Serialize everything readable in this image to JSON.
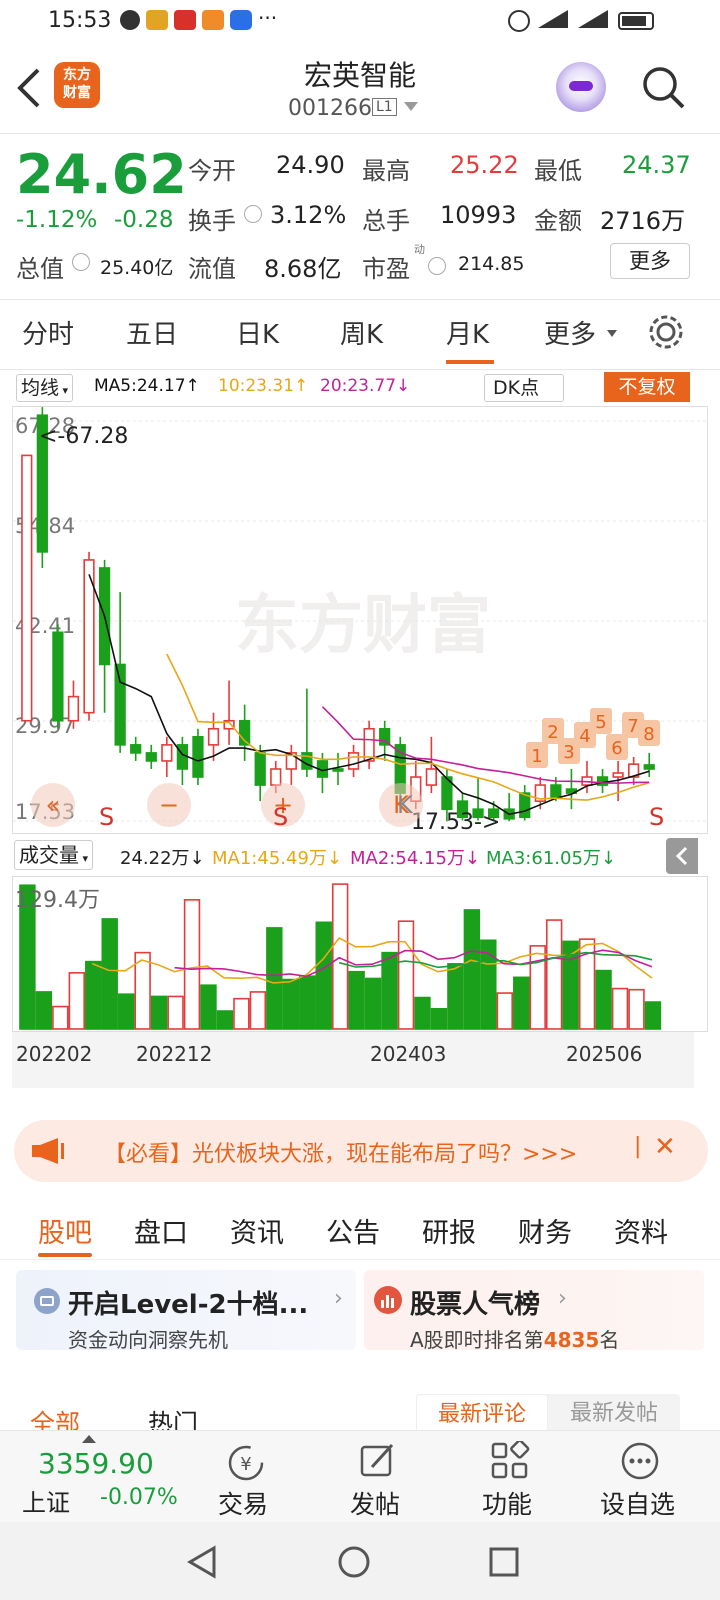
{
  "status_bar": {
    "time": "15:53",
    "dots": "···"
  },
  "header": {
    "logo_text": "东方\n财富",
    "title": "宏英智能",
    "code": "001266",
    "level": "L1"
  },
  "quote": {
    "price": "24.62",
    "change_pct": "-1.12%",
    "change": "-0.28",
    "open_label": "今开",
    "open": "24.90",
    "high_label": "最高",
    "high": "25.22",
    "low_label": "最低",
    "low": "24.37",
    "turnover_label": "换手",
    "turnover": "3.12%",
    "volume_label": "总手",
    "volume": "10993",
    "amount_label": "金额",
    "amount": "2716万",
    "mktcap_label": "总值",
    "mktcap": "25.40亿",
    "float_label": "流值",
    "float": "8.68亿",
    "pe_label": "市盈",
    "pe_sup": "动",
    "pe": "214.85",
    "more": "更多"
  },
  "tabs": [
    "分时",
    "五日",
    "日K",
    "周K",
    "月K",
    "更多"
  ],
  "active_tab": "月K",
  "ma_bar": {
    "selector": "均线",
    "ma5": "MA5:24.17↑",
    "ma10": "10:23.31↑",
    "ma20": "20:23.77↓",
    "dk": "DK点",
    "adjust": "不复权"
  },
  "chart_data": {
    "type": "candlestick",
    "y_ticks": [
      "67.28",
      "54.84",
      "42.41",
      "29.97",
      "17.53"
    ],
    "ylim": [
      17.53,
      67.28
    ],
    "max_label": "<-67.28",
    "min_label": "17.53->",
    "watermark": "东方财富",
    "markers": [
      "1",
      "2",
      "3",
      "4",
      "5",
      "6",
      "7",
      "8"
    ],
    "signals": [
      "S",
      "S",
      "K",
      "S"
    ],
    "nav_icons": [
      "«",
      "−",
      "+",
      "K"
    ],
    "candles": [
      {
        "o": 30,
        "c": 63,
        "h": 63,
        "l": 30,
        "up": true
      },
      {
        "o": 51,
        "c": 68,
        "h": 69,
        "l": 49,
        "up": false
      },
      {
        "o": 41,
        "c": 30,
        "h": 42,
        "l": 29,
        "up": false
      },
      {
        "o": 33,
        "c": 30,
        "h": 35,
        "l": 29,
        "up": true
      },
      {
        "o": 31,
        "c": 50,
        "h": 51,
        "l": 30,
        "up": true
      },
      {
        "o": 49,
        "c": 37,
        "h": 50,
        "l": 31,
        "up": false
      },
      {
        "o": 37,
        "c": 27,
        "h": 46,
        "l": 26,
        "up": false
      },
      {
        "o": 27,
        "c": 26,
        "h": 28,
        "l": 25,
        "up": false
      },
      {
        "o": 26,
        "c": 25,
        "h": 27,
        "l": 24,
        "up": false
      },
      {
        "o": 25,
        "c": 27,
        "h": 28,
        "l": 23,
        "up": true
      },
      {
        "o": 27,
        "c": 24,
        "h": 28,
        "l": 22,
        "up": false
      },
      {
        "o": 28,
        "c": 23,
        "h": 29,
        "l": 22,
        "up": false
      },
      {
        "o": 27,
        "c": 29,
        "h": 31,
        "l": 25,
        "up": true
      },
      {
        "o": 29,
        "c": 30,
        "h": 35,
        "l": 27,
        "up": true
      },
      {
        "o": 30,
        "c": 27,
        "h": 32,
        "l": 25,
        "up": false
      },
      {
        "o": 26,
        "c": 22,
        "h": 27,
        "l": 20,
        "up": false
      },
      {
        "o": 22,
        "c": 24,
        "h": 25,
        "l": 21,
        "up": true
      },
      {
        "o": 24,
        "c": 26,
        "h": 27,
        "l": 22,
        "up": true
      },
      {
        "o": 26,
        "c": 24,
        "h": 34,
        "l": 23,
        "up": false
      },
      {
        "o": 25,
        "c": 23,
        "h": 26,
        "l": 21,
        "up": false
      },
      {
        "o": 24,
        "c": 24,
        "h": 26,
        "l": 22,
        "up": false
      },
      {
        "o": 24,
        "c": 26,
        "h": 27,
        "l": 23,
        "up": true
      },
      {
        "o": 25,
        "c": 29,
        "h": 30,
        "l": 24,
        "up": true
      },
      {
        "o": 29,
        "c": 27,
        "h": 30,
        "l": 25,
        "up": false
      },
      {
        "o": 27,
        "c": 21,
        "h": 28,
        "l": 20,
        "up": false
      },
      {
        "o": 20,
        "c": 23,
        "h": 25,
        "l": 19,
        "up": true
      },
      {
        "o": 22,
        "c": 24,
        "h": 28,
        "l": 21,
        "up": true
      },
      {
        "o": 23,
        "c": 19,
        "h": 24,
        "l": 17.5,
        "up": false
      },
      {
        "o": 20,
        "c": 18,
        "h": 21,
        "l": 17.6,
        "up": false
      },
      {
        "o": 19,
        "c": 18,
        "h": 23,
        "l": 17.6,
        "up": false
      },
      {
        "o": 18,
        "c": 19,
        "h": 20,
        "l": 17.5,
        "up": false
      },
      {
        "o": 19,
        "c": 17.8,
        "h": 21,
        "l": 17.5,
        "up": false
      },
      {
        "o": 18,
        "c": 21,
        "h": 22,
        "l": 17.6,
        "up": false
      },
      {
        "o": 20,
        "c": 22,
        "h": 23,
        "l": 19,
        "up": true
      },
      {
        "o": 20.5,
        "c": 22,
        "h": 23,
        "l": 20,
        "up": false
      },
      {
        "o": 21,
        "c": 21.5,
        "h": 24,
        "l": 19,
        "up": false
      },
      {
        "o": 22,
        "c": 23,
        "h": 25,
        "l": 21,
        "up": true
      },
      {
        "o": 22,
        "c": 23,
        "h": 24,
        "l": 21,
        "up": false
      },
      {
        "o": 23,
        "c": 23.5,
        "h": 25,
        "l": 20,
        "up": true
      },
      {
        "o": 23,
        "c": 24.6,
        "h": 25.5,
        "l": 22,
        "up": true
      },
      {
        "o": 24,
        "c": 24.5,
        "h": 26,
        "l": 23,
        "up": false
      }
    ],
    "volume": {
      "label": "成交量",
      "values_text": {
        "vol": "24.22万↓",
        "ma1": "MA1:45.49万↓",
        "ma2": "MA2:54.15万↓",
        "ma3": "MA3:61.05万↓"
      },
      "max_label": "129.4万",
      "bars": [
        {
          "v": 128,
          "up": false
        },
        {
          "v": 33,
          "up": false
        },
        {
          "v": 20,
          "up": true
        },
        {
          "v": 50,
          "up": true
        },
        {
          "v": 60,
          "up": false
        },
        {
          "v": 98,
          "up": false
        },
        {
          "v": 31,
          "up": false
        },
        {
          "v": 68,
          "up": true
        },
        {
          "v": 29,
          "up": false
        },
        {
          "v": 29,
          "up": true
        },
        {
          "v": 115,
          "up": true
        },
        {
          "v": 39,
          "up": false
        },
        {
          "v": 16,
          "up": false
        },
        {
          "v": 27,
          "up": true
        },
        {
          "v": 33,
          "up": true
        },
        {
          "v": 90,
          "up": false
        },
        {
          "v": 44,
          "up": false
        },
        {
          "v": 47,
          "up": false
        },
        {
          "v": 95,
          "up": false
        },
        {
          "v": 129,
          "up": true
        },
        {
          "v": 51,
          "up": false
        },
        {
          "v": 45,
          "up": false
        },
        {
          "v": 68,
          "up": false
        },
        {
          "v": 96,
          "up": true
        },
        {
          "v": 28,
          "up": false
        },
        {
          "v": 18,
          "up": false
        },
        {
          "v": 58,
          "up": false
        },
        {
          "v": 106,
          "up": false
        },
        {
          "v": 79,
          "up": false
        },
        {
          "v": 32,
          "up": true
        },
        {
          "v": 46,
          "up": false
        },
        {
          "v": 74,
          "up": true
        },
        {
          "v": 97,
          "up": true
        },
        {
          "v": 78,
          "up": false
        },
        {
          "v": 80,
          "up": true
        },
        {
          "v": 52,
          "up": false
        },
        {
          "v": 36,
          "up": true
        },
        {
          "v": 35,
          "up": true
        },
        {
          "v": 24,
          "up": false
        }
      ]
    },
    "x_ticks": [
      "202202",
      "202212",
      "202403",
      "202506"
    ]
  },
  "promo": {
    "text": "【必看】光伏板块大涨，现在能布局了吗？>>>",
    "sep": "|",
    "close": "✕"
  },
  "section_tabs": [
    "股吧",
    "盘口",
    "资讯",
    "公告",
    "研报",
    "财务",
    "资料"
  ],
  "cards": [
    {
      "title": "开启Level-2十档...",
      "sub": "资金动向洞察先机"
    },
    {
      "title": "股票人气榜",
      "sub_prefix": "A股即时排名第",
      "rank": "4835",
      "sub_suffix": "名"
    }
  ],
  "comment_tabs": {
    "all": "全部",
    "hot": "热门",
    "latest_comment": "最新评论",
    "latest_post": "最新发帖"
  },
  "bottom_nav": {
    "index_value": "3359.90",
    "index_name": "上证",
    "index_change": "-0.07%",
    "trade": "交易",
    "post": "发帖",
    "func": "功能",
    "watch": "设自选"
  },
  "colors": {
    "up": "#e43b3b",
    "down": "#1aa01a",
    "accent": "#e8641c",
    "ma5": "#111111",
    "ma10": "#e6a817",
    "ma20": "#c51f9a"
  }
}
